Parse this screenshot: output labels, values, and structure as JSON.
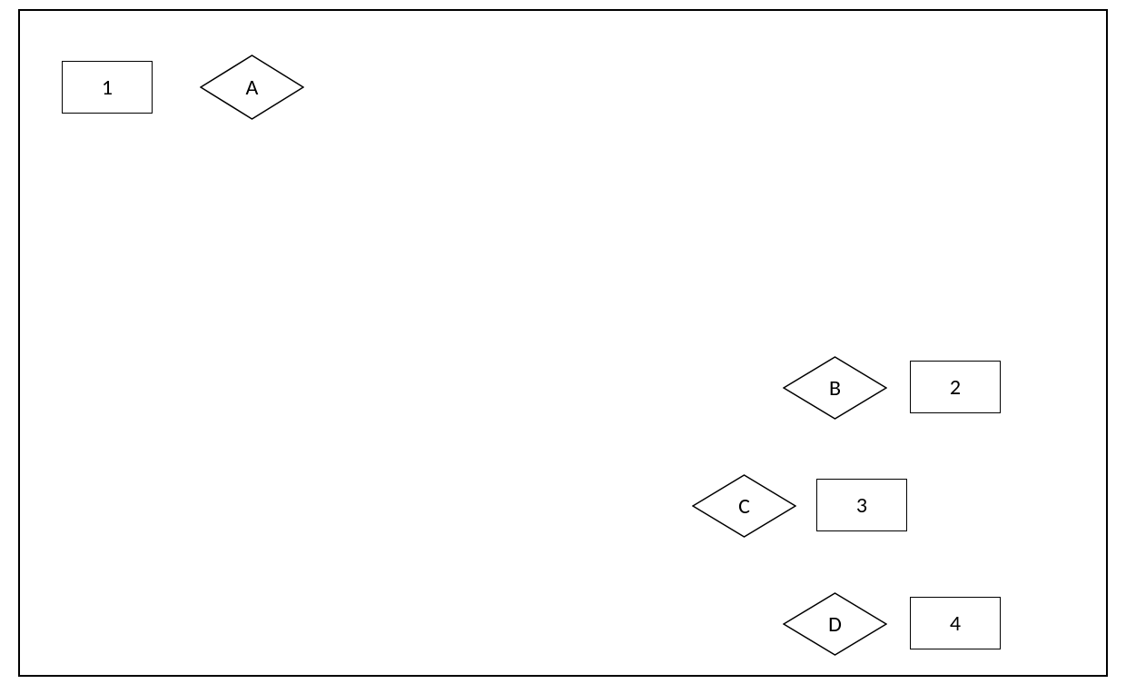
{
  "shapes": {
    "rect1": {
      "label": "1"
    },
    "rect2": {
      "label": "2"
    },
    "rect3": {
      "label": "3"
    },
    "rect4": {
      "label": "4"
    },
    "diamondA": {
      "label": "A"
    },
    "diamondB": {
      "label": "B"
    },
    "diamondC": {
      "label": "C"
    },
    "diamondD": {
      "label": "D"
    }
  }
}
